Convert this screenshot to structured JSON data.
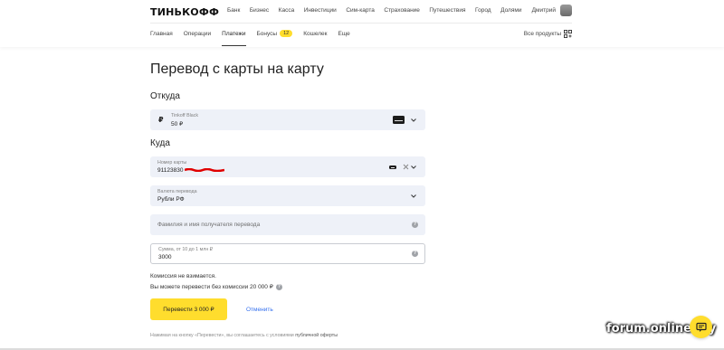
{
  "header": {
    "logo": "ТИНЬКОФФ",
    "nav": [
      "Банк",
      "Бизнес",
      "Касса",
      "Инвестиции",
      "Сим-карта",
      "Страхование",
      "Путешествия",
      "Город",
      "Долями"
    ],
    "user_name": "Дмитрий"
  },
  "subnav": {
    "items": [
      "Главная",
      "Операции",
      "Платежи",
      "Бонусы",
      "Кошелек",
      "Еще"
    ],
    "active": "Платежи",
    "bonus_count": "12",
    "all_products": "Все продукты"
  },
  "page": {
    "title": "Перевод с карты на карту",
    "from_title": "Откуда",
    "from_card": {
      "currency_symbol": "₽",
      "name": "Tinkoff Black",
      "balance": "50 ₽"
    },
    "to_title": "Куда",
    "card_number": {
      "label": "Номер карты",
      "value": "91123830"
    },
    "currency": {
      "label": "Валюта перевода",
      "value": "Рубли РФ"
    },
    "recipient": {
      "placeholder": "Фамилия и имя получателя перевода"
    },
    "amount": {
      "label": "Сумма, от 10 до 1 млн ₽",
      "value": "3000"
    },
    "commission_note": "Комиссия не взимается.",
    "limit_note": "Вы можете перевести без комиссии 20 000 ₽",
    "submit_label": "Перевести 3 000 ₽",
    "cancel_label": "Отменить",
    "footer_text": "Нажимая на кнопку «Перевести», вы соглашаетесь с условиями",
    "footer_link": "публичной оферты"
  },
  "watermark": "forum.onliner.by",
  "colors": {
    "accent": "#ffdd2d",
    "field_bg": "#eef1f8",
    "link": "#336fee"
  }
}
